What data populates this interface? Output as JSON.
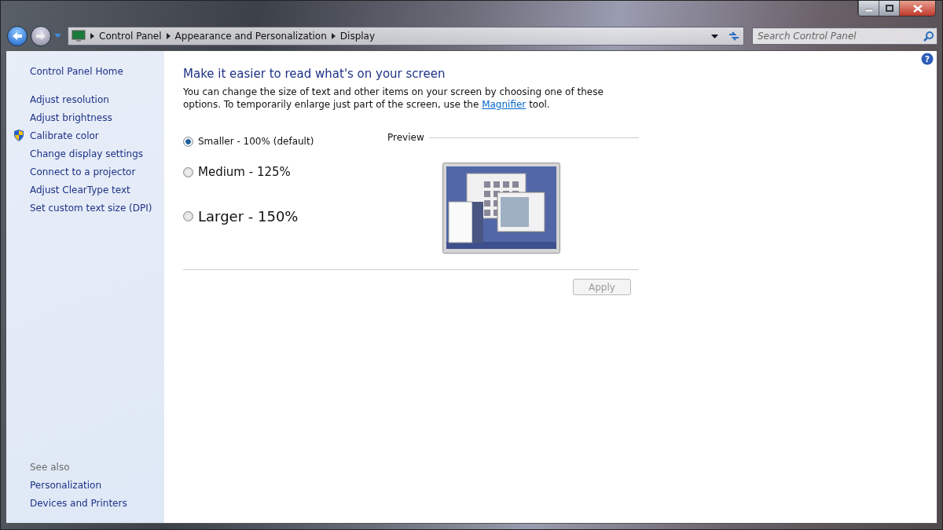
{
  "help": {
    "symbol": "?"
  },
  "address_bar": {
    "crumbs": [
      "Control Panel",
      "Appearance and Personalization",
      "Display"
    ]
  },
  "search": {
    "placeholder": "Search Control Panel"
  },
  "sidebar": {
    "home": "Control Panel Home",
    "items": [
      {
        "label": "Adjust resolution",
        "shield": false
      },
      {
        "label": "Adjust brightness",
        "shield": false
      },
      {
        "label": "Calibrate color",
        "shield": true
      },
      {
        "label": "Change display settings",
        "shield": false
      },
      {
        "label": "Connect to a projector",
        "shield": false
      },
      {
        "label": "Adjust ClearType text",
        "shield": false
      },
      {
        "label": "Set custom text size (DPI)",
        "shield": false
      }
    ],
    "see_also": {
      "heading": "See also",
      "links": [
        "Personalization",
        "Devices and Printers"
      ]
    }
  },
  "main": {
    "title": "Make it easier to read what's on your screen",
    "description": {
      "before": "You can change the size of text and other items on your screen by choosing one of these options. To temporarily enlarge just part of the screen, use the",
      "link": "Magnifier",
      "after": "tool."
    },
    "options": [
      {
        "label": "Smaller - 100% (default)",
        "selected": true
      },
      {
        "label": "Medium - 125%",
        "selected": false
      },
      {
        "label": "Larger - 150%",
        "selected": false
      }
    ],
    "preview_label": "Preview",
    "apply": {
      "label": "Apply",
      "disabled": true
    }
  }
}
